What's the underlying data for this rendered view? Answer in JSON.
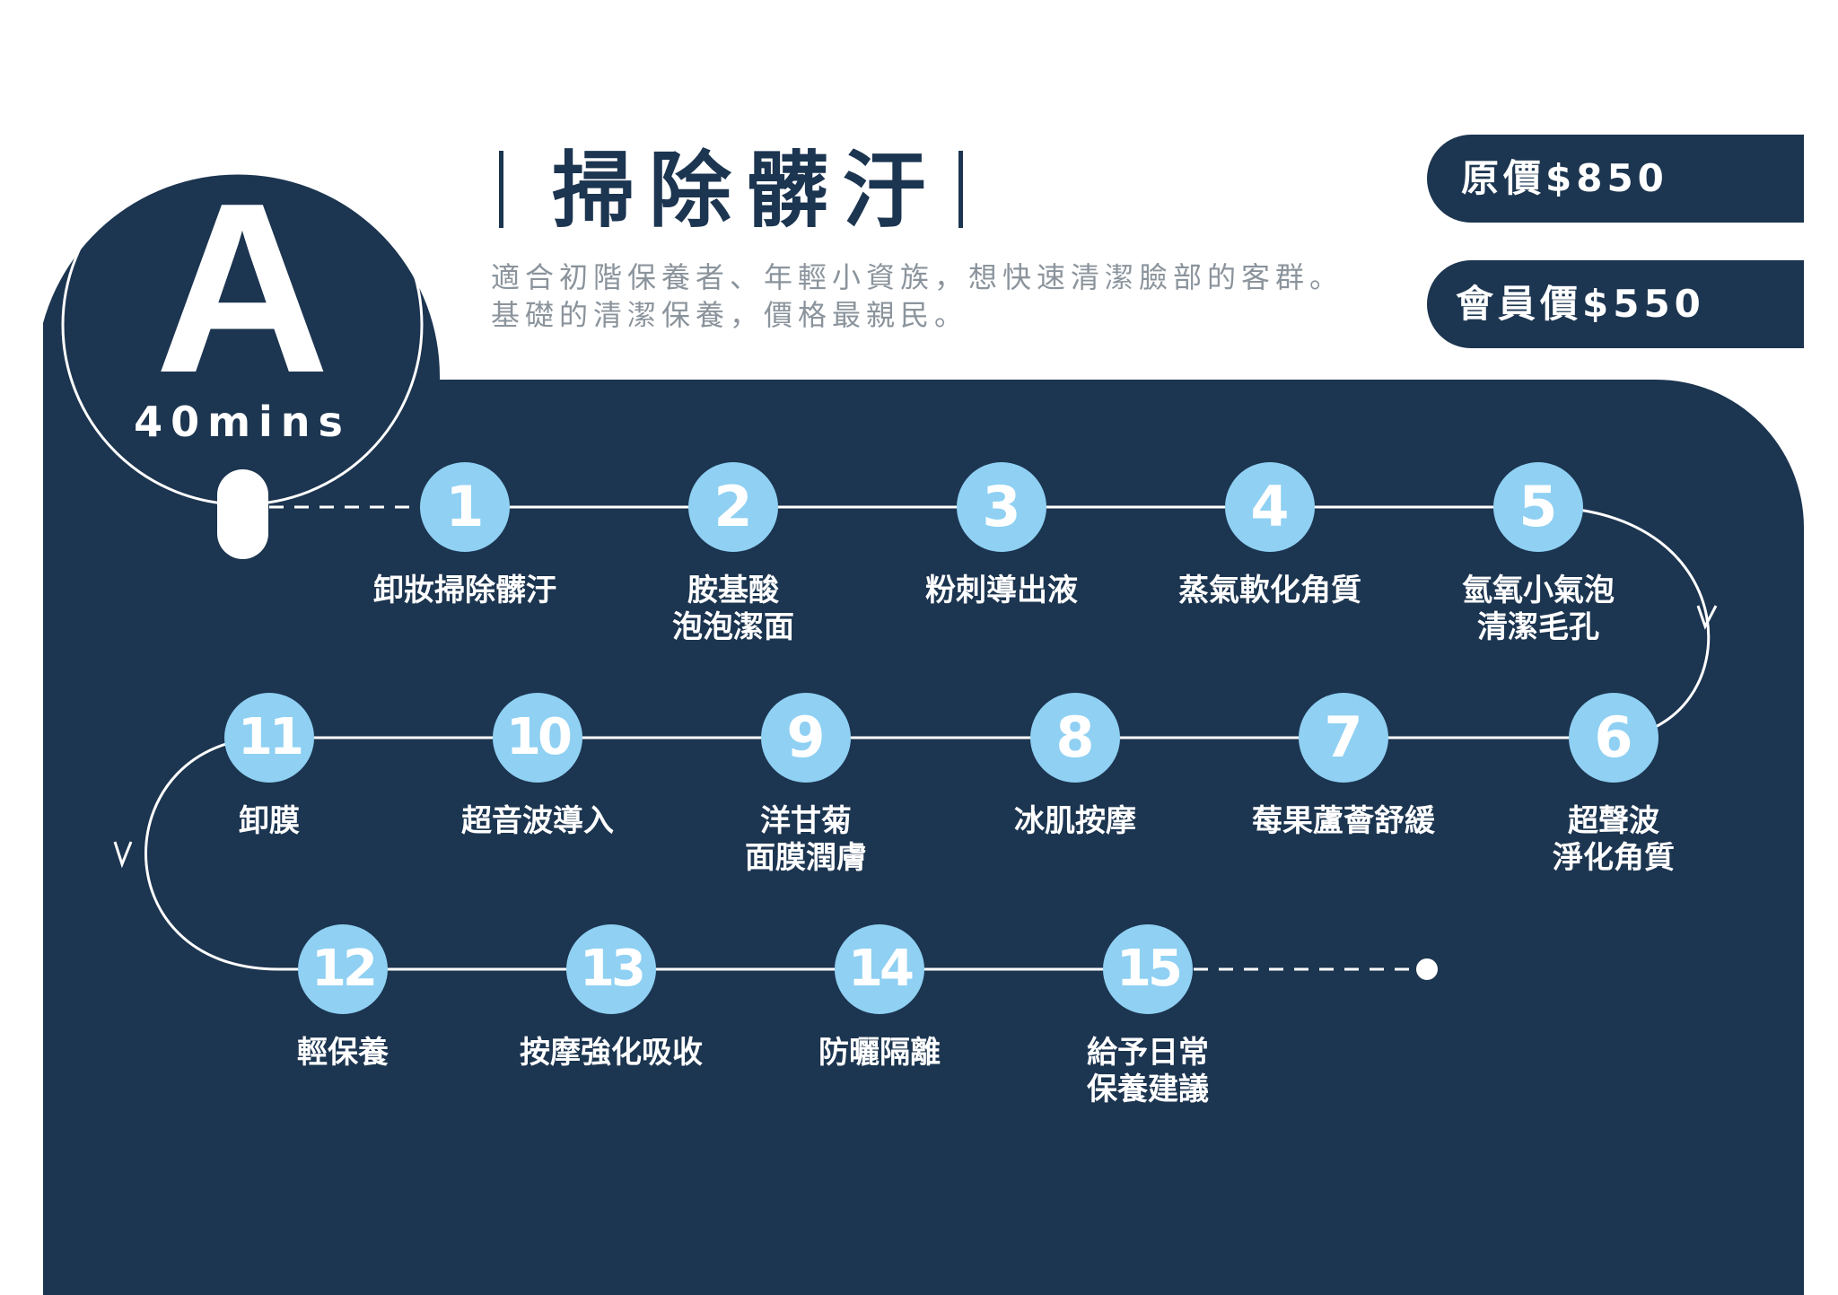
{
  "badge": {
    "letter": "A",
    "duration": "40mins"
  },
  "header": {
    "title": "掃除髒汙",
    "description_lines": [
      "適合初階保養者、年輕小資族，想快速清潔臉部的客群。",
      "基礎的清潔保養，價格最親民。"
    ]
  },
  "prices": {
    "original": "原價$850",
    "member": "會員價$550"
  },
  "colors": {
    "navy": "#1c3550",
    "step_circle": "#8fd0f3",
    "description_text": "#8b949c",
    "white": "#ffffff"
  },
  "steps": [
    {
      "number": "1",
      "lines": [
        "卸妝掃除髒汙"
      ]
    },
    {
      "number": "2",
      "lines": [
        "胺基酸",
        "泡泡潔面"
      ]
    },
    {
      "number": "3",
      "lines": [
        "粉刺導出液"
      ]
    },
    {
      "number": "4",
      "lines": [
        "蒸氣軟化角質"
      ]
    },
    {
      "number": "5",
      "lines": [
        "氫氧小氣泡",
        "清潔毛孔"
      ]
    },
    {
      "number": "6",
      "lines": [
        "超聲波",
        "淨化角質"
      ]
    },
    {
      "number": "7",
      "lines": [
        "莓果蘆薈舒緩"
      ]
    },
    {
      "number": "8",
      "lines": [
        "冰肌按摩"
      ]
    },
    {
      "number": "9",
      "lines": [
        "洋甘菊",
        "面膜潤膚"
      ]
    },
    {
      "number": "10",
      "lines": [
        "超音波導入"
      ]
    },
    {
      "number": "11",
      "lines": [
        "卸膜"
      ]
    },
    {
      "number": "12",
      "lines": [
        "輕保養"
      ]
    },
    {
      "number": "13",
      "lines": [
        "按摩強化吸收"
      ]
    },
    {
      "number": "14",
      "lines": [
        "防曬隔離"
      ]
    },
    {
      "number": "15",
      "lines": [
        "給予日常",
        "保養建議"
      ]
    }
  ]
}
